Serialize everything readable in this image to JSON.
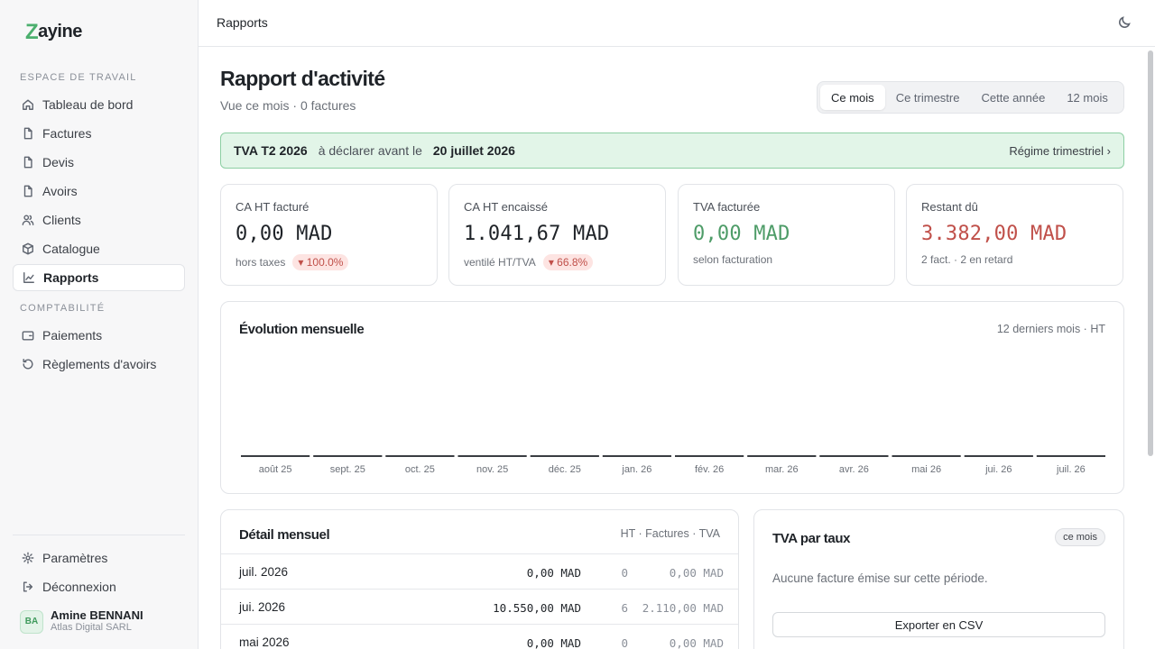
{
  "app": {
    "logo_mark": "Z",
    "logo_rest": "ayine"
  },
  "sidebar": {
    "sections": [
      {
        "label": "ESPACE DE TRAVAIL"
      },
      {
        "label": "COMPTABILITÉ"
      }
    ],
    "items": [
      {
        "label": "Tableau de bord",
        "icon": "home-icon"
      },
      {
        "label": "Factures",
        "icon": "file-icon"
      },
      {
        "label": "Devis",
        "icon": "file-icon"
      },
      {
        "label": "Avoirs",
        "icon": "file-icon"
      },
      {
        "label": "Clients",
        "icon": "users-icon"
      },
      {
        "label": "Catalogue",
        "icon": "box-icon"
      },
      {
        "label": "Rapports",
        "icon": "chart-icon",
        "active": true
      },
      {
        "label": "Paiements",
        "icon": "wallet-icon"
      },
      {
        "label": "Règlements d'avoirs",
        "icon": "refresh-icon"
      }
    ],
    "bottom": [
      {
        "label": "Paramètres",
        "icon": "gear-icon"
      },
      {
        "label": "Déconnexion",
        "icon": "logout-icon"
      }
    ],
    "user": {
      "initials": "BA",
      "name": "Amine BENNANI",
      "company": "Atlas Digital SARL"
    }
  },
  "topbar": {
    "title": "Rapports",
    "theme_icon": "moon-icon"
  },
  "page": {
    "title": "Rapport d'activité",
    "subtitle": "Vue ce mois · 0 factures",
    "periods": [
      "Ce mois",
      "Ce trimestre",
      "Cette année",
      "12 mois"
    ],
    "active_period": "Ce mois"
  },
  "tva_banner": {
    "label": "TVA T2 2026",
    "text": "à déclarer avant le",
    "deadline": "20 juillet 2026",
    "link": "Régime trimestriel ›"
  },
  "kpis": [
    {
      "label": "CA HT facturé",
      "value": "0,00 MAD",
      "foot": "hors taxes",
      "delta": "▾ 100.0%"
    },
    {
      "label": "CA HT encaissé",
      "value": "1.041,67 MAD",
      "foot": "ventilé HT/TVA",
      "delta": "▾ 66.8%"
    },
    {
      "label": "TVA facturée",
      "value": "0,00 MAD",
      "foot": "selon facturation",
      "color": "#4e9c68"
    },
    {
      "label": "Restant dû",
      "value": "3.382,00 MAD",
      "foot": "2 fact. · 2 en retard",
      "color": "#c0504a"
    }
  ],
  "chart": {
    "title": "Évolution mensuelle",
    "meta": "12 derniers mois · HT"
  },
  "chart_data": {
    "type": "bar",
    "categories": [
      "août 25",
      "sept. 25",
      "oct. 25",
      "nov. 25",
      "déc. 25",
      "janv. 26",
      "févr. 26",
      "mars 26",
      "avr. 26",
      "mai 26",
      "juin 26",
      "juil. 26"
    ],
    "tick_labels": [
      "août 25",
      "sept. 25",
      "oct. 25",
      "nov. 25",
      "déc. 25",
      "jan. 26",
      "fév. 26",
      "mar. 26",
      "avr. 26",
      "mai 26",
      "jui. 26",
      "juil. 26"
    ],
    "values": [
      0,
      0,
      0,
      0,
      0,
      0,
      0,
      0,
      0,
      0,
      0,
      0
    ],
    "title": "Évolution mensuelle",
    "xlabel": "",
    "ylabel": "",
    "grid": false,
    "bar_color": "#3a3d42"
  },
  "detail": {
    "title": "Détail mensuel",
    "meta": "HT · Factures · TVA",
    "rows": [
      {
        "month": "juil. 2026",
        "ht": "0,00 MAD",
        "count": "0",
        "tva": "0,00 MAD"
      },
      {
        "month": "jui. 2026",
        "ht": "10.550,00 MAD",
        "count": "6",
        "tva": "2.110,00 MAD"
      },
      {
        "month": "mai 2026",
        "ht": "0,00 MAD",
        "count": "0",
        "tva": "0,00 MAD"
      }
    ]
  },
  "rates": {
    "title": "TVA par taux",
    "badge": "ce mois",
    "empty": "Aucune facture émise sur cette période.",
    "export_label": "Exporter en CSV"
  }
}
